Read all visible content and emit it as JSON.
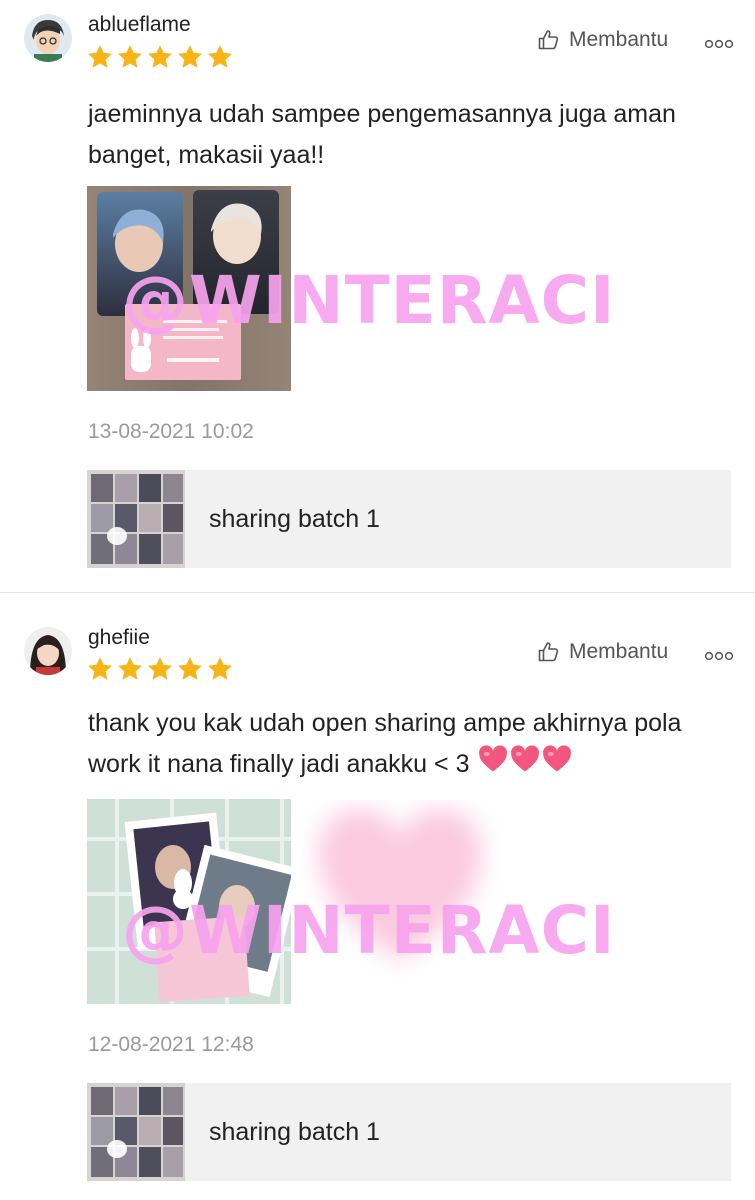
{
  "reviews": [
    {
      "username": "ablueflame",
      "rating": 5,
      "helpful_label": "Membantu",
      "text": "jaeminnya udah sampee pengemasannya juga aman banget, makasii yaa!!",
      "timestamp": "13-08-2021 10:02",
      "variant": "sharing batch 1"
    },
    {
      "username": "ghefiie",
      "rating": 5,
      "helpful_label": "Membantu",
      "text": "thank you kak udah open sharing ampe akhirnya pola work it nana finally jadi anakku < 3",
      "timestamp": "12-08-2021 12:48",
      "variant": "sharing batch 1"
    }
  ],
  "watermark": "@WINTERACI",
  "colors": {
    "star": "#f6b417",
    "watermark": "#f7a3ee",
    "heart_emoji": "#f2557d",
    "timestamp": "#9a9a9a",
    "variant_bg": "#f1f1f1"
  },
  "icons": {
    "helpful": "thumbs-up-outline-icon",
    "more": "more-dots-icon",
    "star": "star-icon",
    "heart": "heart-emoji-icon"
  }
}
